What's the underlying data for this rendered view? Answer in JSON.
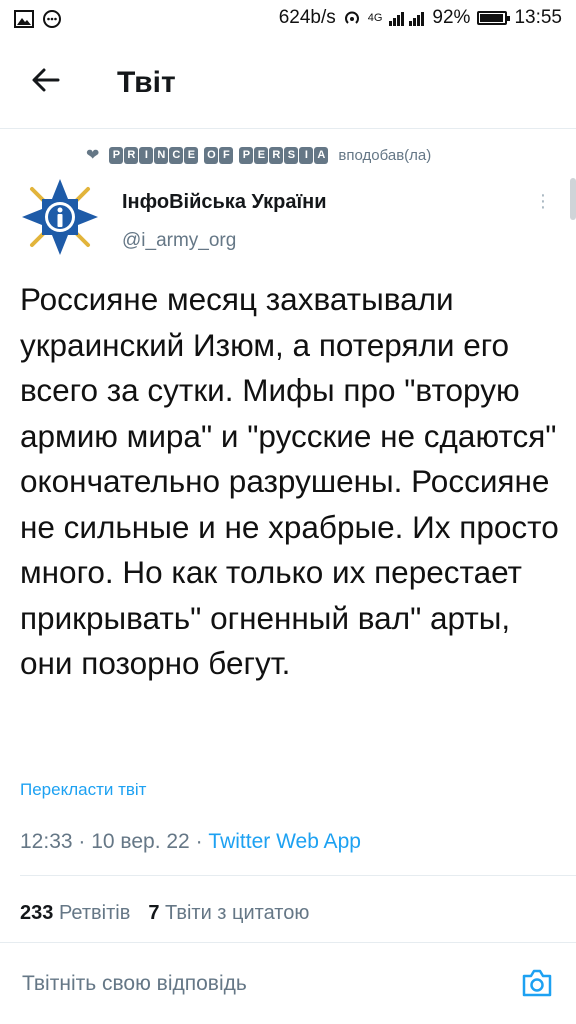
{
  "status_bar": {
    "speed": "624b/s",
    "network": "4G",
    "battery": "92%",
    "time": "13:55",
    "icons": [
      "image-icon",
      "chat-icon",
      "hotspot-icon",
      "signal-icon",
      "battery-icon"
    ]
  },
  "header": {
    "title": "Твіт",
    "back_icon": "arrow-left-icon"
  },
  "liked_by": {
    "words": [
      [
        "P",
        "R",
        "I",
        "N",
        "C",
        "E"
      ],
      [
        "O",
        "F"
      ],
      [
        "P",
        "E",
        "R",
        "S",
        "I",
        "A"
      ]
    ],
    "suffix": "вподобав(ла)",
    "icon": "heart-icon"
  },
  "tweet": {
    "author_name": "ІнфоВійська України",
    "author_handle": "@i_army_org",
    "text": "Россияне месяц захватывали украинский Изюм, а потеряли его всего за сутки. Мифы про \"вторую армию мира\" и \"русские не сдаются\" окончательно разрушены. Россияне не сильные и не храбрые. Их просто много. Но как только их перестает прикрывать\" огненный вал\" арты, они позорно бегут.",
    "translate_label": "Перекласти твіт",
    "time": "12:33",
    "date": "10 вер. 22",
    "source": "Twitter Web App",
    "retweets_count": "233",
    "retweets_label": "Ретвітів",
    "quotes_count": "7",
    "quotes_label": "Твіти з цитатою"
  },
  "reply": {
    "placeholder": "Твітніть свою відповідь",
    "icon": "camera-icon"
  },
  "colors": {
    "accent": "#1da1f2",
    "secondary_text": "#657786",
    "emblem_blue": "#1e5ba8",
    "emblem_gold": "#e2b43b"
  }
}
